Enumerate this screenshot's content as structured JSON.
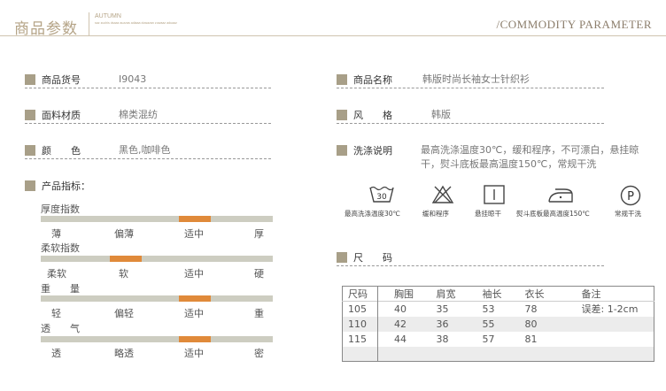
{
  "header": {
    "title": "商品参数",
    "box_big": "AUTUMN",
    "box_small": "saz zuchis dsaaz auzzas adiaaa duwazan zuwaaz aduaaz",
    "right_title": "/COMMODITY PARAMETER"
  },
  "left": {
    "item_no_label": "商品货号",
    "item_no_value": "I9043",
    "fabric_label": "面料材质",
    "fabric_value": "棉类混纺",
    "color_label": "颜　　色",
    "color_value": "黑色,咖啡色",
    "indicators_label": "产品指标："
  },
  "indicators": [
    {
      "title": "厚度指数",
      "ticks": [
        "薄",
        "偏薄",
        "适中",
        "厚"
      ],
      "level": 2
    },
    {
      "title": "柔软指数",
      "ticks": [
        "柔软",
        "软",
        "适中",
        "硬"
      ],
      "level": 1
    },
    {
      "title": "重　　量",
      "ticks": [
        "轻",
        "偏轻",
        "适中",
        "重"
      ],
      "level": 2
    },
    {
      "title": "透　　气",
      "ticks": [
        "透",
        "略透",
        "适中",
        "密"
      ],
      "level": 2
    }
  ],
  "right": {
    "name_label": "商品名称",
    "name_value": "韩版时尚长袖女士针织衫",
    "style_label": "风　　格",
    "style_value": "韩版",
    "wash_label": "洗涤说明",
    "wash_value_line1": "最高洗涤温度30℃，缓和程序，不可漂白，悬挂晾",
    "wash_value_line2": "干，熨斗底板最高温度150℃，常规干洗",
    "size_label": "尺　　码"
  },
  "care": [
    {
      "icon": "wash-30-icon",
      "text": "30",
      "caption": "最高洗涤温度30℃"
    },
    {
      "icon": "no-bleach-icon",
      "caption": "缓和程序"
    },
    {
      "icon": "hang-dry-icon",
      "caption": "悬挂晾干"
    },
    {
      "icon": "iron-icon",
      "caption": "熨斗底板最高温度150℃"
    },
    {
      "icon": "dry-clean-p-icon",
      "text": "P",
      "caption": "常规干洗"
    }
  ],
  "size_table": {
    "headers": [
      "尺码",
      "胸围",
      "肩宽",
      "袖长",
      "衣长",
      "备注"
    ],
    "rows": [
      [
        "105",
        "40",
        "35",
        "53",
        "78",
        "误差: 1-2cm"
      ],
      [
        "110",
        "42",
        "36",
        "55",
        "80",
        ""
      ],
      [
        "115",
        "44",
        "38",
        "57",
        "81",
        ""
      ],
      [
        "",
        "",
        "",
        "",
        "",
        ""
      ]
    ]
  },
  "colors": {
    "accent": "#e08a3a",
    "track": "#cdcdc1",
    "square": "#a89f88",
    "header": "#b5a487"
  }
}
